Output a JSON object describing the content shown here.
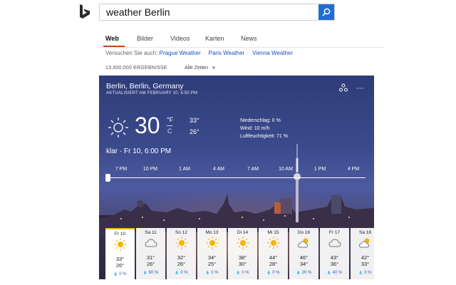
{
  "search": {
    "query": "weather Berlin"
  },
  "tabs": [
    "Web",
    "Bilder",
    "Videos",
    "Karten",
    "News"
  ],
  "suggestions": {
    "prefix": "Versuchen Sie auch:",
    "items": [
      "Prague Weather",
      "Paris Weather",
      "Vienna Weather"
    ]
  },
  "results_count": "13,600,000 ERGEBNISSE",
  "time_filter": "Alle Zeiten",
  "weather": {
    "location": "Berlin, Berlin, Germany",
    "updated": "AKTUALISIERT AM FEBRUARY 10, 5:50 PM",
    "temp": "30",
    "unit_f": "°F",
    "unit_c": "C",
    "high": "33°",
    "low": "26°",
    "precip": "Niederschlag: 0 %",
    "wind": "Wind: 10 m/h",
    "humidity": "Luftfeuchtigkeit: 71 %",
    "condition": "klar · Fr 10, 6:00 PM",
    "hours": [
      "7 PM",
      "10 PM",
      "1 AM",
      "4 AM",
      "7 AM",
      "10 AM",
      "1 PM",
      "4 PM"
    ],
    "forecast": [
      {
        "day": "Fr 10",
        "hi": "33°",
        "lo": "26°",
        "rain": "0 %",
        "icon": "sun-icon"
      },
      {
        "day": "Sa 11",
        "hi": "31°",
        "lo": "26°",
        "rain": "60 %",
        "icon": "cloud-icon"
      },
      {
        "day": "So 12",
        "hi": "32°",
        "lo": "26°",
        "rain": "0 %",
        "icon": "sun-icon"
      },
      {
        "day": "Mo 13",
        "hi": "34°",
        "lo": "25°",
        "rain": "0 %",
        "icon": "sun-icon"
      },
      {
        "day": "Di 14",
        "hi": "38°",
        "lo": "30°",
        "rain": "0 %",
        "icon": "sun-icon"
      },
      {
        "day": "Mi 15",
        "hi": "44°",
        "lo": "28°",
        "rain": "0 %",
        "icon": "sun-icon"
      },
      {
        "day": "Do 16",
        "hi": "46°",
        "lo": "34°",
        "rain": "20 %",
        "icon": "partly-cloudy-icon"
      },
      {
        "day": "Fr 17",
        "hi": "43°",
        "lo": "36°",
        "rain": "40 %",
        "icon": "cloud-icon"
      },
      {
        "day": "Sa 18",
        "hi": "42°",
        "lo": "33°",
        "rain": "0 %",
        "icon": "partly-cloudy-icon"
      }
    ]
  },
  "colors": {
    "accent": "#1f6fd1",
    "tab_underline": "#c04b1f",
    "selected_day": "#f2b705",
    "sky": "#3b4a8c"
  }
}
